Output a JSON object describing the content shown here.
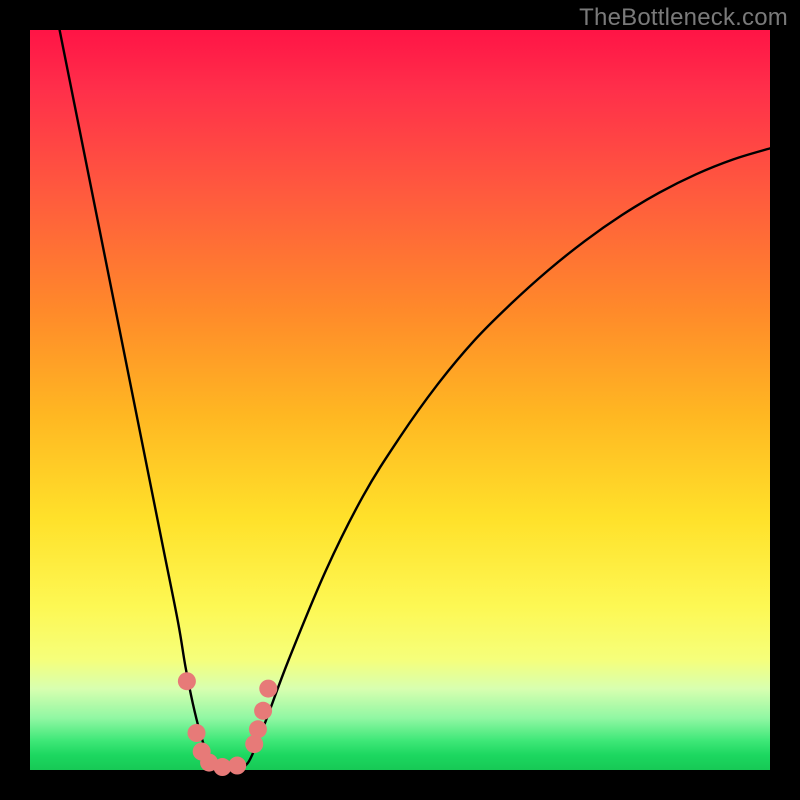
{
  "watermark": "TheBottleneck.com",
  "chart_data": {
    "type": "line",
    "title": "",
    "xlabel": "",
    "ylabel": "",
    "xlim": [
      0,
      100
    ],
    "ylim": [
      0,
      100
    ],
    "grid": false,
    "series": [
      {
        "name": "bottleneck-curve",
        "x": [
          4,
          6,
          8,
          10,
          12,
          14,
          16,
          18,
          20,
          21,
          22,
          23,
          24,
          25,
          26,
          27,
          28,
          29,
          30,
          32,
          35,
          40,
          45,
          50,
          55,
          60,
          65,
          70,
          75,
          80,
          85,
          90,
          95,
          100
        ],
        "y": [
          100,
          90,
          80,
          70,
          60,
          50,
          40,
          30,
          20,
          14,
          9,
          5,
          2,
          0.5,
          0,
          0,
          0,
          0.5,
          2,
          7,
          15,
          27,
          37,
          45,
          52,
          58,
          63,
          67.5,
          71.5,
          75,
          78,
          80.5,
          82.5,
          84
        ]
      }
    ],
    "annotations": {
      "minimum_x": 26.5,
      "markers": [
        {
          "x": 21.2,
          "y": 12
        },
        {
          "x": 22.5,
          "y": 5
        },
        {
          "x": 23.2,
          "y": 2.5
        },
        {
          "x": 24.2,
          "y": 1
        },
        {
          "x": 26.0,
          "y": 0.4
        },
        {
          "x": 28.0,
          "y": 0.6
        },
        {
          "x": 30.3,
          "y": 3.5
        },
        {
          "x": 30.8,
          "y": 5.5
        },
        {
          "x": 31.5,
          "y": 8
        },
        {
          "x": 32.2,
          "y": 11
        }
      ]
    },
    "colors": {
      "curve": "#000000",
      "markers": "#e77a78",
      "background_top": "#ff1446",
      "background_bottom": "#17c955"
    }
  }
}
